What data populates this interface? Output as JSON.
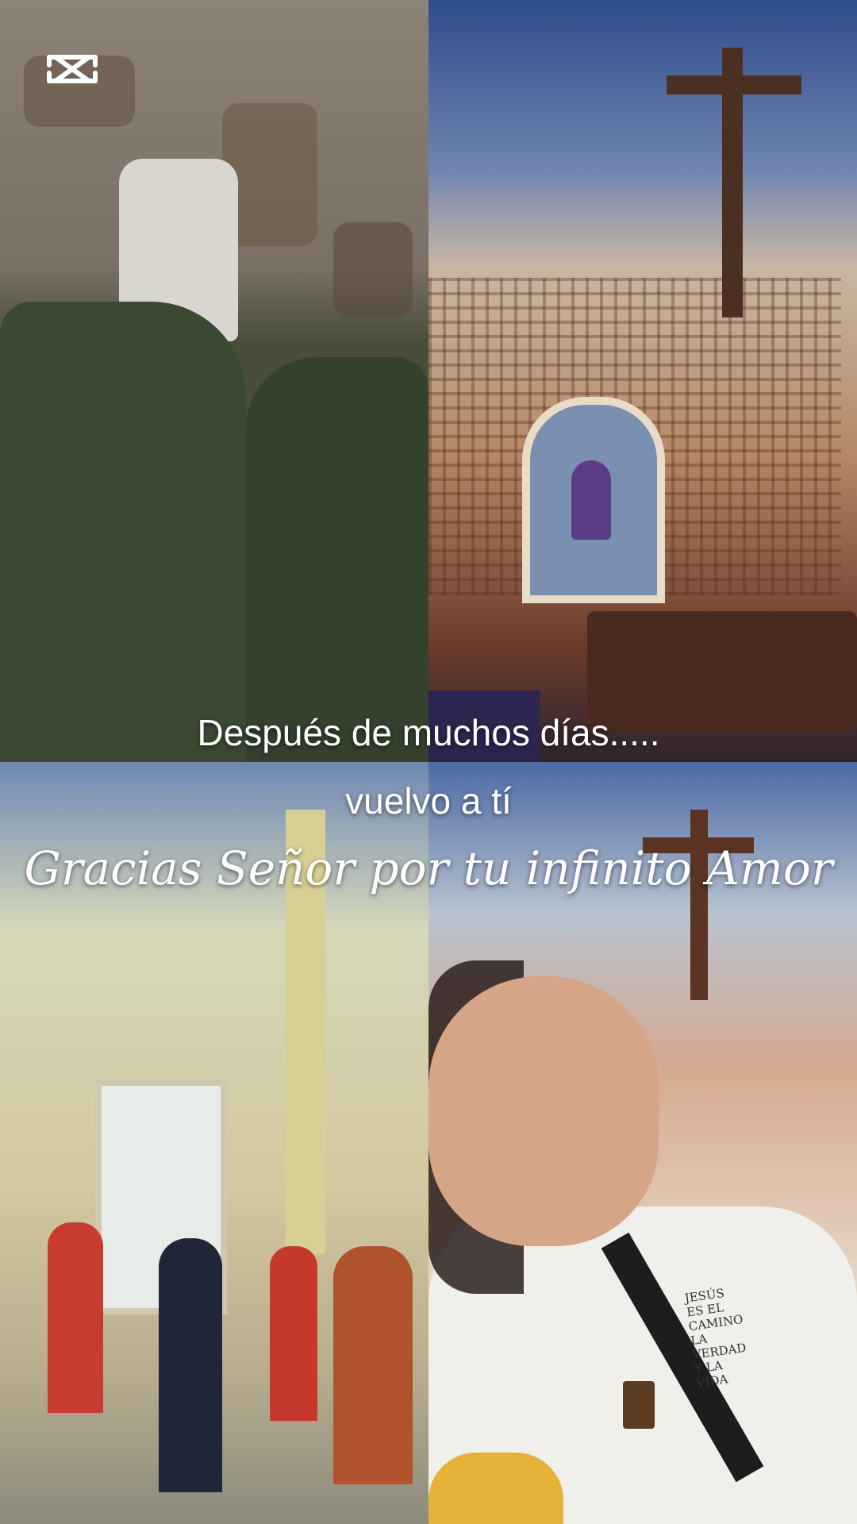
{
  "overlay": {
    "line1": "Después de muchos días.....",
    "line2": "vuelvo a tí",
    "line3": "Gracias Señor por tu infinito Amor"
  },
  "shirt_print": {
    "line1": "JESÚS",
    "line2": "ES EL",
    "line3": "CAMINO",
    "line4": "LA",
    "line5": "VERDAD",
    "line6": "Y LA",
    "line7": "VIDA"
  },
  "icons": {
    "logo": "capcut-logo-icon"
  },
  "colors": {
    "caption_text": "#ffffff",
    "altar_cloth": "#2c2550",
    "acolyte_red": "#c83c30"
  }
}
